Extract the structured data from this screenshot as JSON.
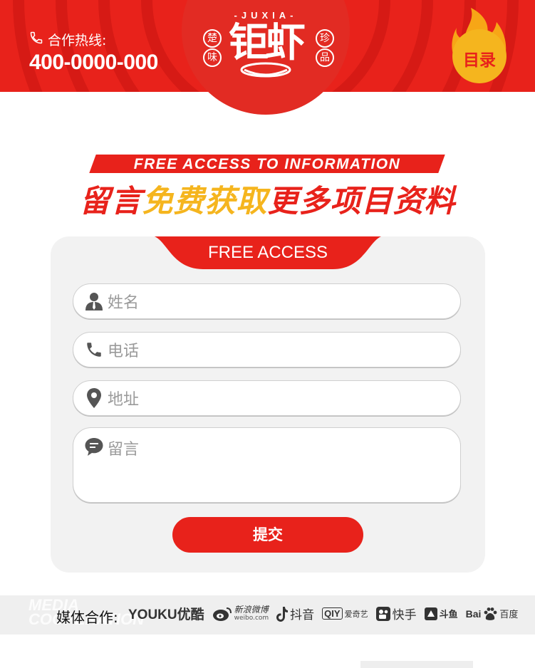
{
  "header": {
    "hotline_label": "合作热线:",
    "hotline_number": "400-0000-000",
    "logo_subtitle": "-JUXIA-",
    "logo_text": "钜虾",
    "seals": [
      "楚",
      "味",
      "珍",
      "品"
    ],
    "catalog_label": "目录",
    "colors": {
      "primary": "#e8221b",
      "flame": "#f7a616",
      "flame_core": "#f5b51e"
    }
  },
  "headline": {
    "banner": "FREE ACCESS TO INFORMATION",
    "part1": "留言",
    "part2": "免费获取",
    "part3": "更多项目资料",
    "colors": {
      "red": "#e8221b",
      "gold": "#f5b51e"
    }
  },
  "form": {
    "tab_label": "FREE ACCESS",
    "fields": [
      {
        "icon": "user-icon",
        "placeholder": "姓名"
      },
      {
        "icon": "phone-icon",
        "placeholder": "电话"
      },
      {
        "icon": "location-pin-icon",
        "placeholder": "地址"
      },
      {
        "icon": "message-icon",
        "placeholder": "留言"
      }
    ],
    "submit_label": "提交"
  },
  "media": {
    "watermark_line1": "MEDIA",
    "watermark_line2": "COOPERATION",
    "label": "媒体合作:",
    "partners": {
      "youku": "YOUKU优酷",
      "weibo": "新浪微博",
      "weibo_sub": "weibo.com",
      "douyin": "抖音",
      "iqiyi_badge": "QIY",
      "iqiyi": "爱奇艺",
      "kuaishou": "快手",
      "douyu": "斗鱼",
      "baidu_left": "Bai",
      "baidu_right": "百度"
    }
  }
}
